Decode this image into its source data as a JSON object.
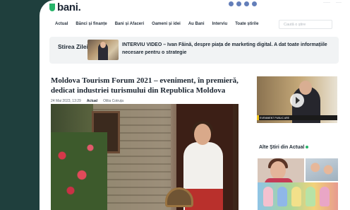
{
  "site": {
    "logo_text": "bani.",
    "top_links": [
      "·····",
      "····"
    ]
  },
  "nav": {
    "items": [
      "Actual",
      "Bănci și finanțe",
      "Bani și Afaceri",
      "Oameni și idei",
      "Au Bani",
      "Interviu",
      "Toate știrile"
    ],
    "search_placeholder": "Caută o știre"
  },
  "news_bar": {
    "label": "Stirea Zilei",
    "text": "INTERVIU VIDEO – Ivan Fâină, despre piața de marketing digital. A dat toate informațiile necesare pentru o strategie"
  },
  "article": {
    "title": "Moldova Tourism Forum 2021 – eveniment, în premieră, dedicat industriei turismului din Republica Moldova",
    "date": "24 Mai 2023, 13:29",
    "category": "Actual",
    "author": "Olilia Cotruța"
  },
  "sidebar": {
    "video_caption": "EVENIMENT PUBLIC ARE",
    "alte_title": "Alte Știri din Actual"
  },
  "colors": {
    "page_bg": "#1f3f3d",
    "accent": "#27b46a"
  }
}
